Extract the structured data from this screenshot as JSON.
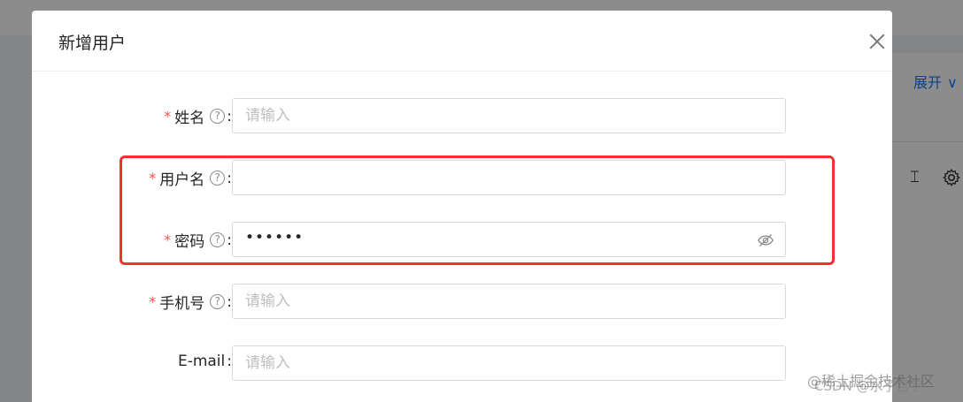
{
  "background": {
    "expand_label": "展开",
    "expand_chevron": "∨"
  },
  "modal": {
    "title": "新增用户",
    "fields": [
      {
        "label": "姓名",
        "required": "*",
        "help": "?",
        "colon": ":",
        "placeholder": "请输入",
        "value": ""
      },
      {
        "label": "用户名",
        "required": "*",
        "help": "?",
        "colon": ":",
        "placeholder": "",
        "value": ""
      },
      {
        "label": "密码",
        "required": "*",
        "help": "?",
        "colon": ":",
        "placeholder": "",
        "value": "••••••"
      },
      {
        "label": "手机号",
        "required": "*",
        "help": "?",
        "colon": ":",
        "placeholder": "请输入",
        "value": ""
      },
      {
        "label": "E-mail",
        "colon": ":",
        "placeholder": "请输入",
        "value": ""
      }
    ]
  },
  "watermark": {
    "line1": "@稀土掘金技术社区",
    "line2": "CSDN @水子哲宇"
  },
  "colors": {
    "highlight": "#f23030",
    "required": "#ff4d4f",
    "accent": "#1677ff"
  }
}
